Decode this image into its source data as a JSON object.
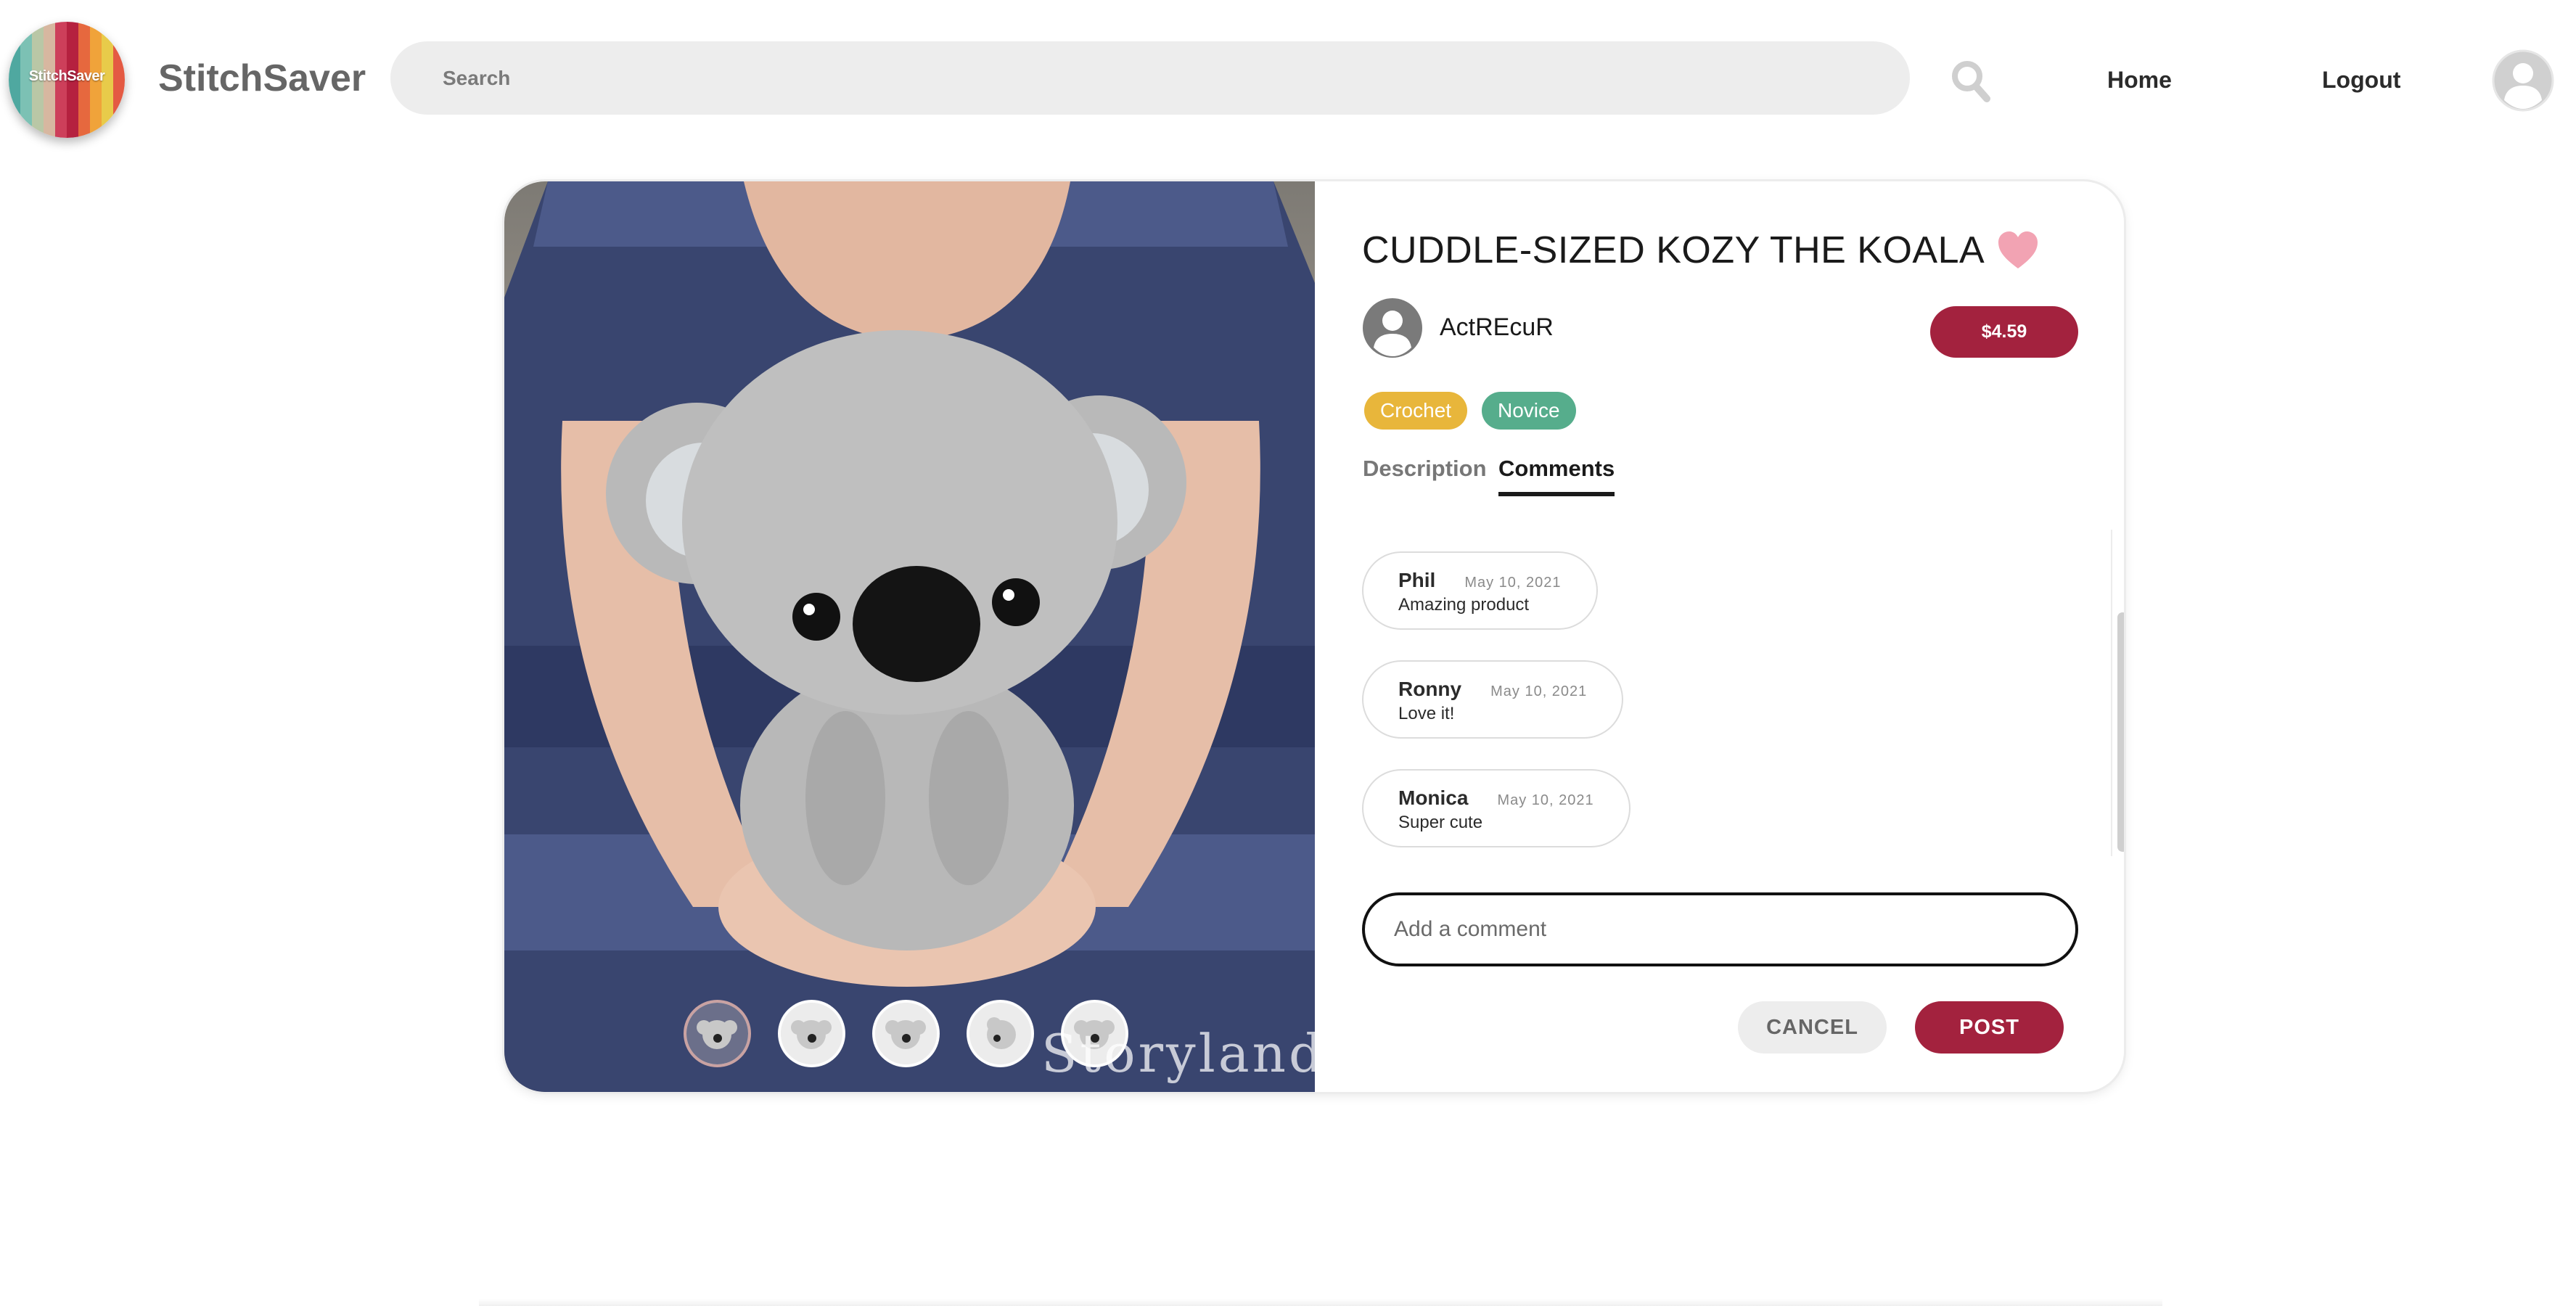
{
  "header": {
    "logo_text": "StitchSaver",
    "brand_name": "StitchSaver",
    "search_placeholder": "Search",
    "search_icon": "search-icon",
    "nav": {
      "home": "Home",
      "logout": "Logout"
    },
    "avatar_icon": "user-avatar-icon"
  },
  "product": {
    "title": "CUDDLE-SIZED KOZY THE KOALA",
    "favorite_icon": "heart-icon",
    "favorite_color": "#f2a3b3",
    "author": "ActREcuR",
    "price": "$4.59",
    "tags": [
      {
        "label": "Crochet",
        "color": "#e8b63b"
      },
      {
        "label": "Novice",
        "color": "#56ad8c"
      }
    ],
    "photo_watermark": "Storyland Ar",
    "thumbnail_count": 5
  },
  "tabs": {
    "description": "Description",
    "comments": "Comments",
    "active": "Comments"
  },
  "comments": [
    {
      "name": "Phil",
      "date": "May 10, 2021",
      "text": "Amazing product"
    },
    {
      "name": "Ronny",
      "date": "May 10, 2021",
      "text": "Love it!"
    },
    {
      "name": "Monica",
      "date": "May 10, 2021",
      "text": "Super cute"
    }
  ],
  "comment_form": {
    "placeholder": "Add a comment",
    "value": "",
    "cancel_label": "CANCEL",
    "post_label": "POST"
  },
  "colors": {
    "accent": "#a3223e",
    "brand_text": "#666666"
  }
}
